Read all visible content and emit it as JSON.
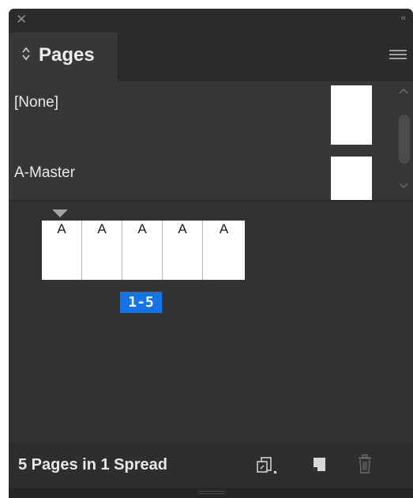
{
  "titlebar": {
    "close_glyph": "✕",
    "collapse_glyph": "‹‹"
  },
  "tab": {
    "label": "Pages",
    "icon": "updown-arrows-icon"
  },
  "panel_menu": {
    "icon": "hamburger-menu-icon"
  },
  "masters": [
    {
      "label": "[None]"
    },
    {
      "label": "A-Master"
    }
  ],
  "spread": {
    "pages": [
      "A",
      "A",
      "A",
      "A",
      "A"
    ],
    "label": "1-5",
    "selected": true,
    "selection_color": "#1473e6"
  },
  "footer": {
    "status": "5 Pages in 1 Spread",
    "icons": [
      "edit-page-size-icon",
      "new-page-icon",
      "delete-page-icon"
    ]
  },
  "colors": {
    "panel_bg": "#323232",
    "header_bg": "#2b2b2b",
    "masters_bg": "#373737",
    "text": "#e8e8e8",
    "accent": "#1473e6"
  }
}
